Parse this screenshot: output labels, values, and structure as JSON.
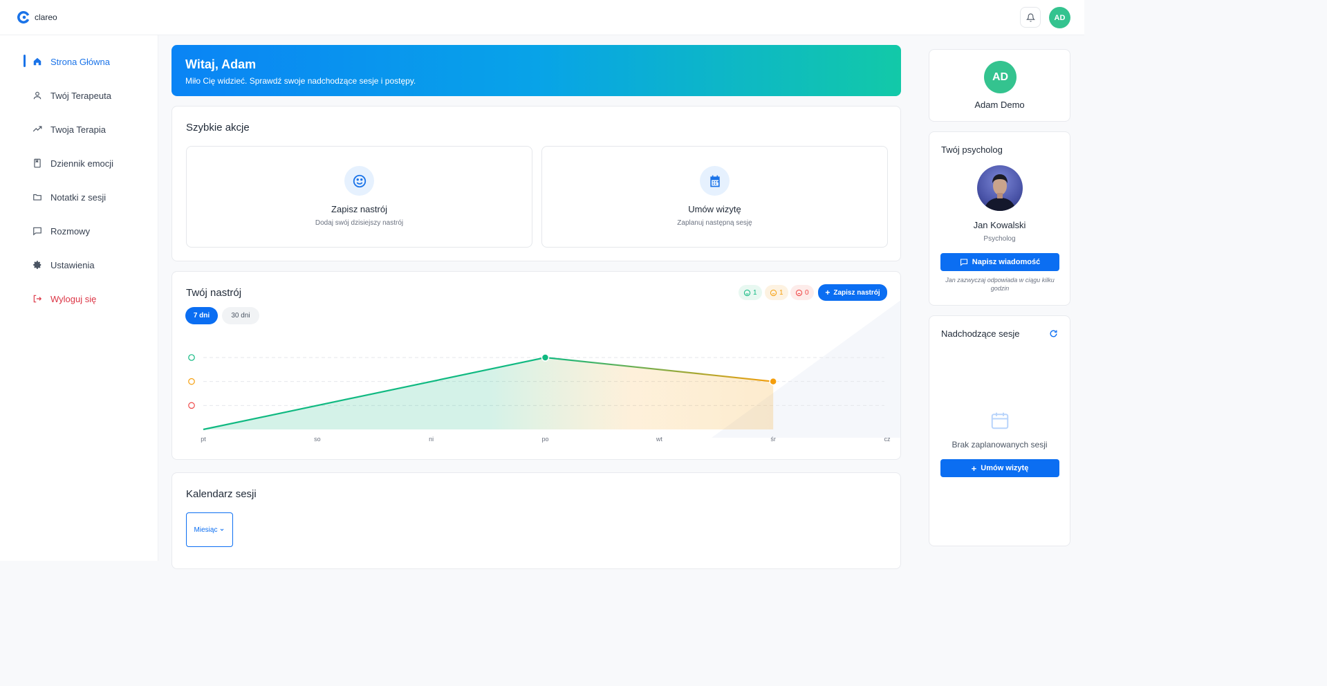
{
  "app": {
    "name": "clareo",
    "user_initials": "AD"
  },
  "sidebar": {
    "items": [
      {
        "label": "Strona Główna",
        "icon": "home-icon"
      },
      {
        "label": "Twój Terapeuta",
        "icon": "user-icon"
      },
      {
        "label": "Twoja Terapia",
        "icon": "trend-icon"
      },
      {
        "label": "Dziennik emocji",
        "icon": "book-icon"
      },
      {
        "label": "Notatki z sesji",
        "icon": "folder-icon"
      },
      {
        "label": "Rozmowy",
        "icon": "chat-icon"
      },
      {
        "label": "Ustawienia",
        "icon": "gear-icon"
      },
      {
        "label": "Wyloguj się",
        "icon": "logout-icon"
      }
    ]
  },
  "hero": {
    "title": "Witaj, Adam",
    "subtitle": "Miło Cię widzieć. Sprawdź swoje nadchodzące sesje i postępy."
  },
  "quick_actions": {
    "title": "Szybkie akcje",
    "items": [
      {
        "title": "Zapisz nastrój",
        "subtitle": "Dodaj swój dzisiejszy nastrój"
      },
      {
        "title": "Umów wizytę",
        "subtitle": "Zaplanuj następną sesję"
      }
    ]
  },
  "mood": {
    "title": "Twój nastrój",
    "counts": {
      "good": "1",
      "neutral": "1",
      "bad": "0"
    },
    "add_label": "Zapisz nastrój",
    "ranges": [
      "7 dni",
      "30 dni"
    ],
    "selected_range": "7 dni"
  },
  "chart_data": {
    "type": "area",
    "categories": [
      "pt",
      "so",
      "ni",
      "po",
      "wt",
      "śr",
      "cz"
    ],
    "y_levels": [
      "bad",
      "neutral",
      "good"
    ],
    "points": [
      {
        "x": "pt",
        "y": 0
      },
      {
        "x": "po",
        "y": 3
      },
      {
        "x": "śr",
        "y": 2
      }
    ],
    "ylim": [
      0,
      3
    ],
    "grid": true,
    "colors": {
      "good": "#10b981",
      "neutral": "#f59e0b",
      "bad": "#ef4444"
    }
  },
  "calendar": {
    "title": "Kalendarz sesji",
    "view": "Miesiąc"
  },
  "profile": {
    "initials": "AD",
    "name": "Adam Demo"
  },
  "psychologist": {
    "title": "Twój psycholog",
    "name": "Jan Kowalski",
    "role": "Psycholog",
    "message_label": "Napisz wiadomość",
    "note": "Jan zazwyczaj odpowiada w ciągu kilku godzin"
  },
  "sessions": {
    "title": "Nadchodzące sesje",
    "empty": "Brak zaplanowanych sesji",
    "book_label": "Umów wizytę"
  }
}
